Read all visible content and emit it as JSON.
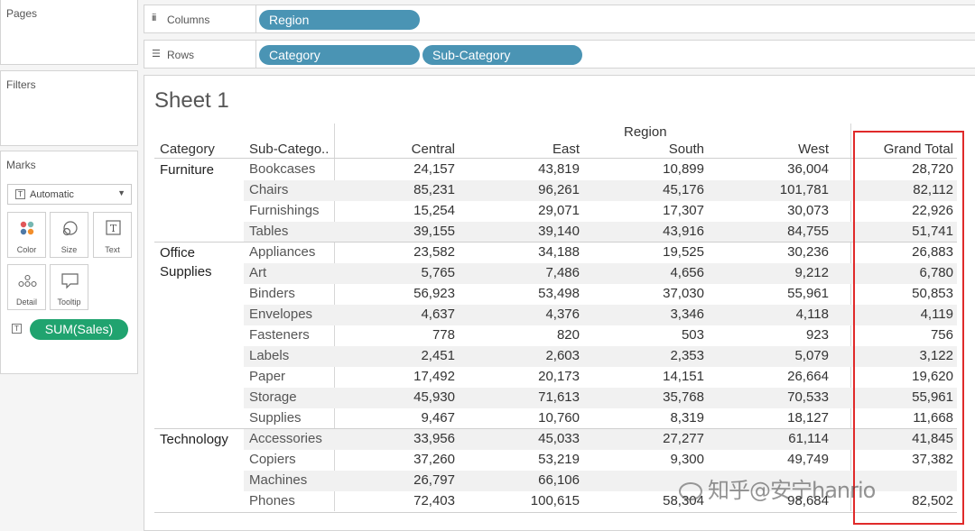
{
  "left_panel": {
    "pages_title": "Pages",
    "filters_title": "Filters",
    "marks_title": "Marks",
    "mark_type": "Automatic",
    "mark_type_icon": "text-t-icon",
    "mark_buttons": [
      {
        "label": "Color",
        "icon": "color-dots-icon"
      },
      {
        "label": "Size",
        "icon": "size-icon"
      },
      {
        "label": "Text",
        "icon": "text-t-icon"
      },
      {
        "label": "Detail",
        "icon": "detail-dots-icon"
      },
      {
        "label": "Tooltip",
        "icon": "tooltip-icon"
      }
    ],
    "field_pill": "SUM(Sales)",
    "field_pill_color": "#20a36f"
  },
  "shelves": {
    "columns_label": "Columns",
    "rows_label": "Rows",
    "columns_pills": [
      "Region"
    ],
    "rows_pills": [
      "Category",
      "Sub-Category"
    ],
    "pill_color": "#4a94b4"
  },
  "sheet": {
    "title": "Sheet 1",
    "region_header": "Region",
    "category_header": "Category",
    "subcategory_header": "Sub-Catego..",
    "column_headers": [
      "Central",
      "East",
      "South",
      "West",
      "Grand Total"
    ],
    "highlight_color": "#e02a2a"
  },
  "table": {
    "categories": [
      {
        "name": "Furniture",
        "label_lines": [
          "Furniture"
        ],
        "rows": [
          {
            "sub": "Bookcases",
            "values": [
              "24,157",
              "43,819",
              "10,899",
              "36,004",
              "28,720"
            ]
          },
          {
            "sub": "Chairs",
            "values": [
              "85,231",
              "96,261",
              "45,176",
              "101,781",
              "82,112"
            ]
          },
          {
            "sub": "Furnishings",
            "values": [
              "15,254",
              "29,071",
              "17,307",
              "30,073",
              "22,926"
            ]
          },
          {
            "sub": "Tables",
            "values": [
              "39,155",
              "39,140",
              "43,916",
              "84,755",
              "51,741"
            ]
          }
        ]
      },
      {
        "name": "Office Supplies",
        "label_lines": [
          "Office",
          "Supplies"
        ],
        "rows": [
          {
            "sub": "Appliances",
            "values": [
              "23,582",
              "34,188",
              "19,525",
              "30,236",
              "26,883"
            ]
          },
          {
            "sub": "Art",
            "values": [
              "5,765",
              "7,486",
              "4,656",
              "9,212",
              "6,780"
            ]
          },
          {
            "sub": "Binders",
            "values": [
              "56,923",
              "53,498",
              "37,030",
              "55,961",
              "50,853"
            ]
          },
          {
            "sub": "Envelopes",
            "values": [
              "4,637",
              "4,376",
              "3,346",
              "4,118",
              "4,119"
            ]
          },
          {
            "sub": "Fasteners",
            "values": [
              "778",
              "820",
              "503",
              "923",
              "756"
            ]
          },
          {
            "sub": "Labels",
            "values": [
              "2,451",
              "2,603",
              "2,353",
              "5,079",
              "3,122"
            ]
          },
          {
            "sub": "Paper",
            "values": [
              "17,492",
              "20,173",
              "14,151",
              "26,664",
              "19,620"
            ]
          },
          {
            "sub": "Storage",
            "values": [
              "45,930",
              "71,613",
              "35,768",
              "70,533",
              "55,961"
            ]
          },
          {
            "sub": "Supplies",
            "values": [
              "9,467",
              "10,760",
              "8,319",
              "18,127",
              "11,668"
            ]
          }
        ]
      },
      {
        "name": "Technology",
        "label_lines": [
          "Technology"
        ],
        "rows": [
          {
            "sub": "Accessories",
            "values": [
              "33,956",
              "45,033",
              "27,277",
              "61,114",
              "41,845"
            ]
          },
          {
            "sub": "Copiers",
            "values": [
              "37,260",
              "53,219",
              "9,300",
              "49,749",
              "37,382"
            ]
          },
          {
            "sub": "Machines",
            "values": [
              "26,797",
              "66,106",
              "",
              "",
              ""
            ]
          },
          {
            "sub": "Phones",
            "values": [
              "72,403",
              "100,615",
              "58,304",
              "98,684",
              "82,502"
            ]
          }
        ]
      }
    ]
  },
  "watermark": "知乎@安宁hanrio"
}
